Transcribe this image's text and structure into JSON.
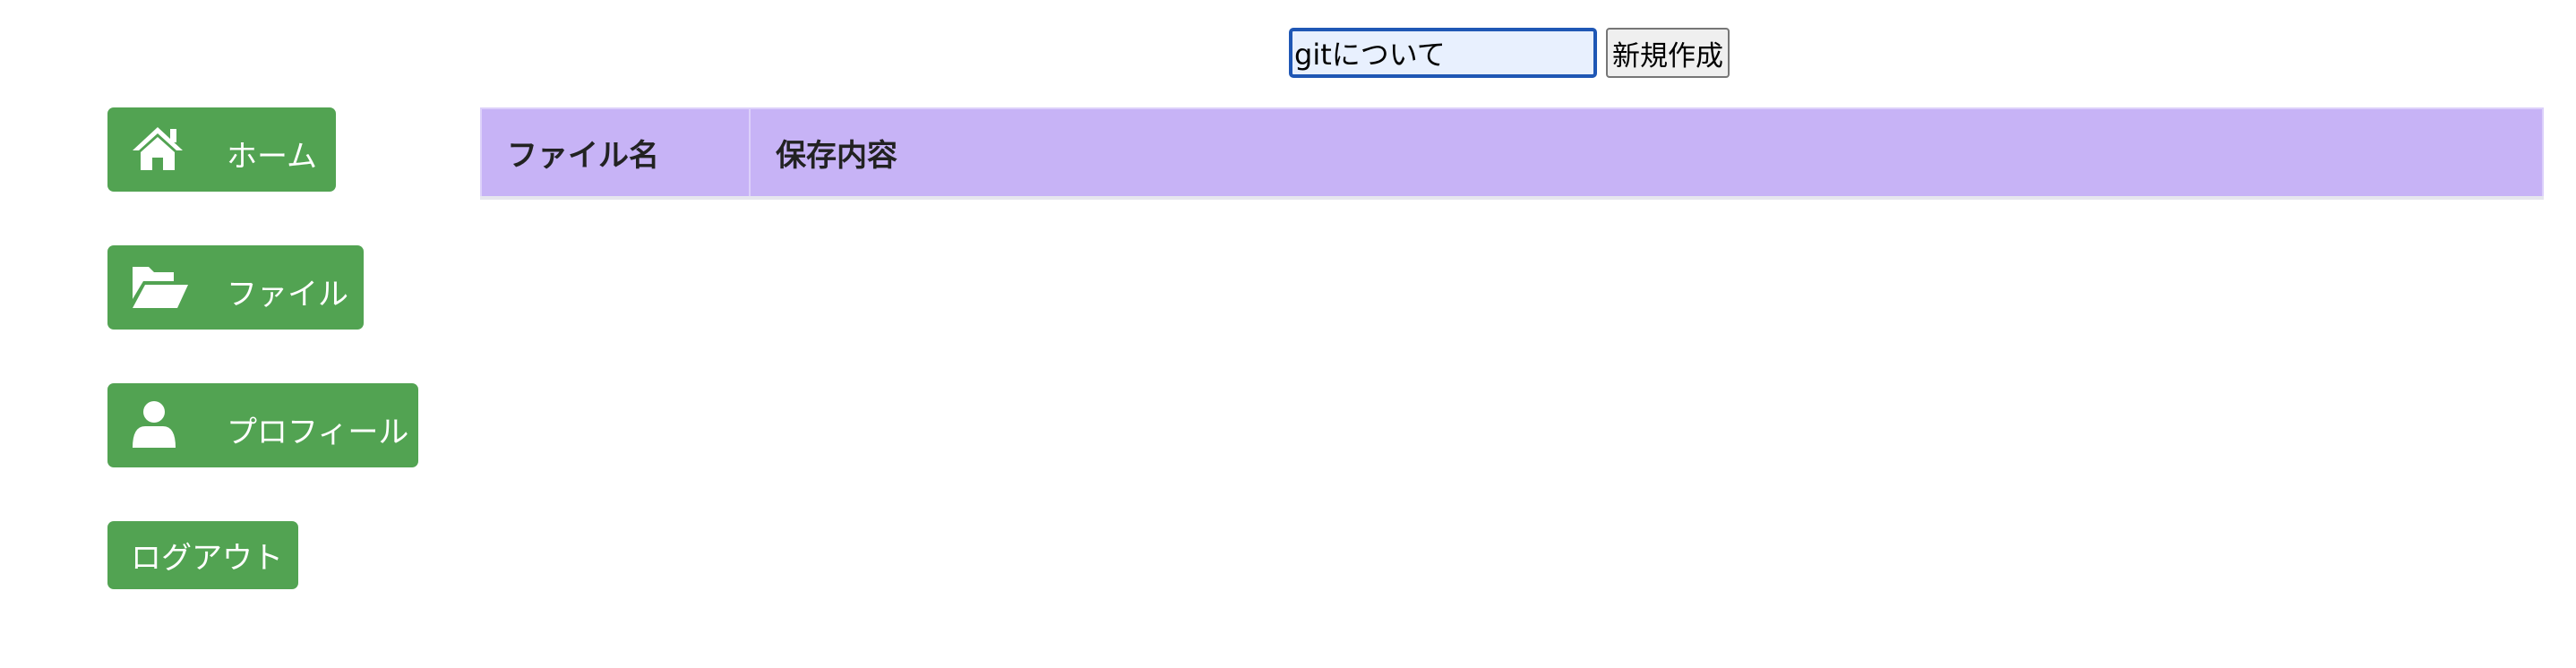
{
  "form": {
    "title_input_value": "gitについて",
    "create_button_label": "新規作成"
  },
  "sidebar": {
    "items": [
      {
        "label": "ホーム",
        "icon": "home-icon"
      },
      {
        "label": "ファイル",
        "icon": "folder-open-icon"
      },
      {
        "label": "プロフィール",
        "icon": "user-icon"
      },
      {
        "label": "ログアウト"
      }
    ]
  },
  "table": {
    "headers": [
      "ファイル名",
      "保存内容"
    ],
    "rows": []
  },
  "colors": {
    "nav_button": "#52a352",
    "table_header": "#c7b3f6",
    "input_border": "#1f57b5",
    "input_background": "#e8f0fe"
  }
}
